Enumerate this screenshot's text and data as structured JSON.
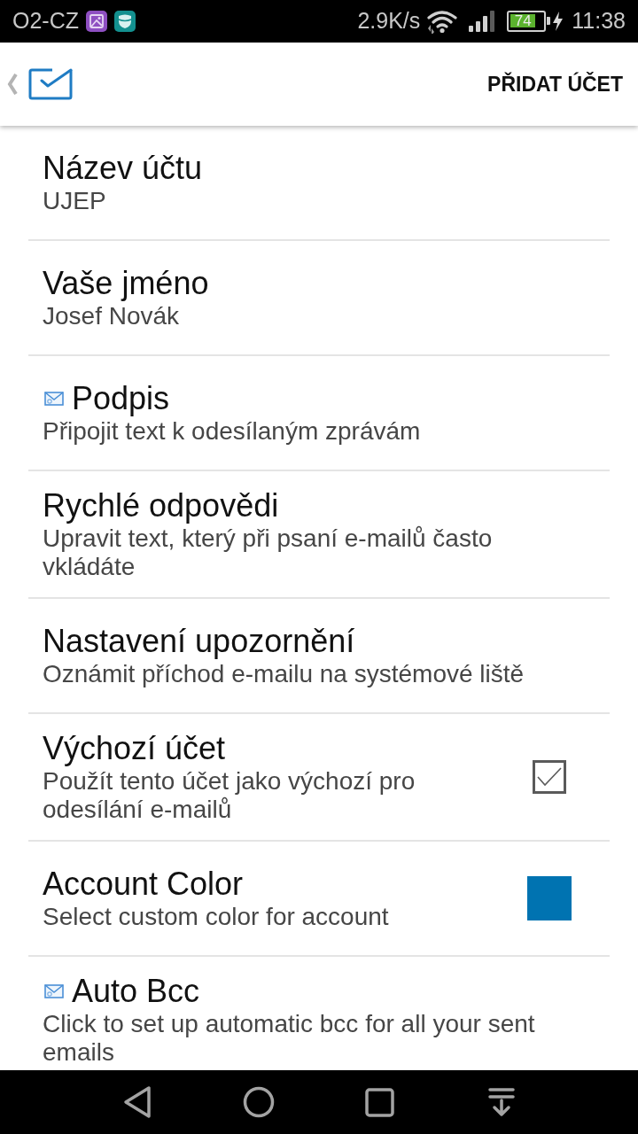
{
  "status_bar": {
    "carrier": "O2-CZ",
    "notification_icons": [
      {
        "kind": "picture"
      },
      {
        "kind": "shield"
      }
    ],
    "net_speed": "2.9K/s",
    "battery": "74",
    "time": "11:38"
  },
  "app_bar": {
    "action": "PŘIDAT ÚČET"
  },
  "settings": [
    {
      "kind": "plain",
      "title": "Název účtu",
      "summary": "UJEP"
    },
    {
      "kind": "plain",
      "title": "Vaše jméno",
      "summary": "Josef Novák"
    },
    {
      "kind": "with-icon",
      "title": "Podpis",
      "summary": "Připojit text k odesílaným zprávám"
    },
    {
      "kind": "plain",
      "title": "Rychlé odpovědi",
      "summary": "Upravit text, který při psaní e-mailů často vkládáte"
    },
    {
      "kind": "plain",
      "title": "Nastavení upozornění",
      "summary": "Oznámit příchod e-mailu na systémové liště"
    },
    {
      "kind": "checkbox",
      "title": "Výchozí účet",
      "summary": "Použít tento účet jako výchozí pro odesílání e-mailů",
      "checked": true
    },
    {
      "kind": "color",
      "title": "Account Color",
      "summary": "Select custom color for account",
      "color": "#0073b1"
    },
    {
      "kind": "with-icon",
      "title": "Auto Bcc",
      "summary": "Click to set up automatic bcc for all your sent emails"
    }
  ],
  "nav_bar": {
    "buttons": [
      {
        "kind": "back"
      },
      {
        "kind": "home"
      },
      {
        "kind": "recents"
      },
      {
        "kind": "hide"
      }
    ]
  }
}
